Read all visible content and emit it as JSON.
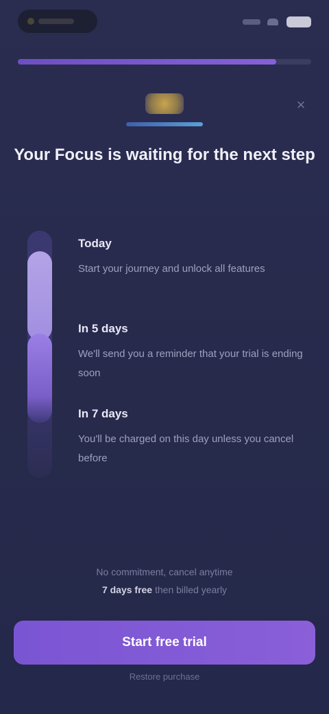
{
  "status_bar": {
    "icons": [
      "signal-icon",
      "wifi-icon",
      "battery-icon"
    ]
  },
  "progress": {
    "fraction": 0.88
  },
  "close": {
    "icon": "close-icon",
    "glyph": "×"
  },
  "logo": {
    "icon": "app-logo"
  },
  "headline": "Your Focus is waiting for the next step",
  "timeline": {
    "steps": [
      {
        "title": "Today",
        "description": "Start your journey and unlock all features"
      },
      {
        "title": "In 5 days",
        "description": "We'll send you a reminder that your trial is ending soon"
      },
      {
        "title": "In 7 days",
        "description": "You'll be charged on this day unless you cancel before"
      }
    ]
  },
  "terms": {
    "line1": "No commitment, cancel anytime",
    "line2_strong": "7 days free",
    "line2_rest": "then billed yearly"
  },
  "cta": {
    "label": "Start free trial"
  },
  "fine_print": "Restore purchase"
}
